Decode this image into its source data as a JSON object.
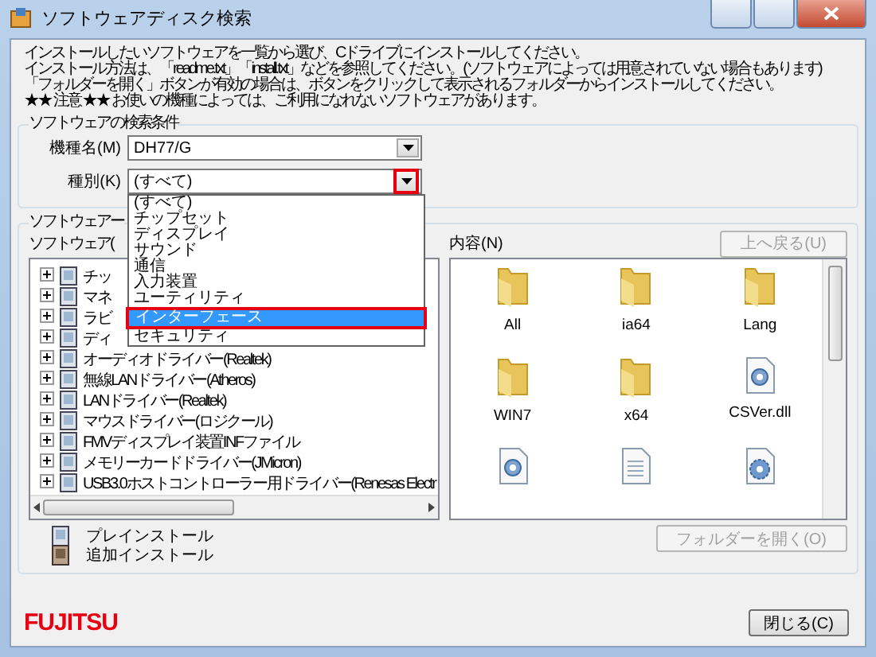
{
  "window": {
    "title": "ソフトウェアディスク検索"
  },
  "instructions": [
    "インストールしたいソフトウェアを一覧から選び、Cドライブにインストールしてください。",
    "インストール方法は、「readme.txt」「install.txt」などを参照してください。(ソフトウェアによっては用意されていない場合もあります)",
    "「フォルダーを開く」ボタンが有効の場合は、ボタンをクリックして表示されるフォルダーからインストールしてください。",
    "★★ 注意 ★★ お使いの機種によっては、ご利用になれないソフトウェアがあります。"
  ],
  "search_conditions": {
    "title": "ソフトウェアの検索条件",
    "fields": [
      {
        "label": "機種名(M)",
        "value": "DH77/G",
        "callout": false
      },
      {
        "label": "種別(K)",
        "value": "(すべて)",
        "callout": true
      }
    ]
  },
  "dropdown": {
    "items": [
      {
        "label": "(すべて)",
        "selected": false
      },
      {
        "label": "チップセット",
        "selected": false
      },
      {
        "label": "ディスプレイ",
        "selected": false
      },
      {
        "label": "サウンド",
        "selected": false
      },
      {
        "label": "通信",
        "selected": false
      },
      {
        "label": "入力装置",
        "selected": false
      },
      {
        "label": "ユーティリティ",
        "selected": false
      },
      {
        "label": "インターフェース",
        "selected": true
      },
      {
        "label": "セキュリティ",
        "selected": false
      }
    ]
  },
  "software": {
    "title": "ソフトウェアー",
    "tree_label": "ソフトウェア(",
    "tree_items": [
      {
        "label": "チッ",
        "expanded": false
      },
      {
        "label": "マネ",
        "expanded": false
      },
      {
        "label": "ラビ",
        "expanded": false
      },
      {
        "label": "ディ",
        "expanded": false
      },
      {
        "label": "オーディオドライバー(Realtek)",
        "expanded": false
      },
      {
        "label": "無線LANドライバー(Atheros)",
        "expanded": false
      },
      {
        "label": "LANドライバー(Realtek)",
        "expanded": false
      },
      {
        "label": "マウスドライバー(ロジクール)",
        "expanded": false
      },
      {
        "label": "FMVディスプレイ装置INFファイル",
        "expanded": false
      },
      {
        "label": "メモリーカードドライバー(JMicron)",
        "expanded": false
      },
      {
        "label": "USB3.0ホストコントローラー用ドライバー(Renesas Electr",
        "expanded": false
      }
    ],
    "contents_label": "内容(N)",
    "up_button": {
      "label": "上へ戻る(U)",
      "disabled": true
    },
    "files": [
      {
        "name": "All",
        "kind": "folder"
      },
      {
        "name": "ia64",
        "kind": "folder"
      },
      {
        "name": "Lang",
        "kind": "folder"
      },
      {
        "name": "WIN7",
        "kind": "folder"
      },
      {
        "name": "x64",
        "kind": "folder"
      },
      {
        "name": "CSVer.dll",
        "kind": "dll"
      },
      {
        "kind": "dll"
      },
      {
        "kind": "text"
      },
      {
        "kind": "ini"
      }
    ],
    "open_folder_button": {
      "label": "フォルダーを開く(O)",
      "disabled": true
    },
    "legend": [
      {
        "label": "プレインストール",
        "kind": "preinstall"
      },
      {
        "label": "追加インストール",
        "kind": "additional"
      }
    ]
  },
  "logo": "FUJITSU",
  "close_button": {
    "label": "閉じる(C)"
  }
}
